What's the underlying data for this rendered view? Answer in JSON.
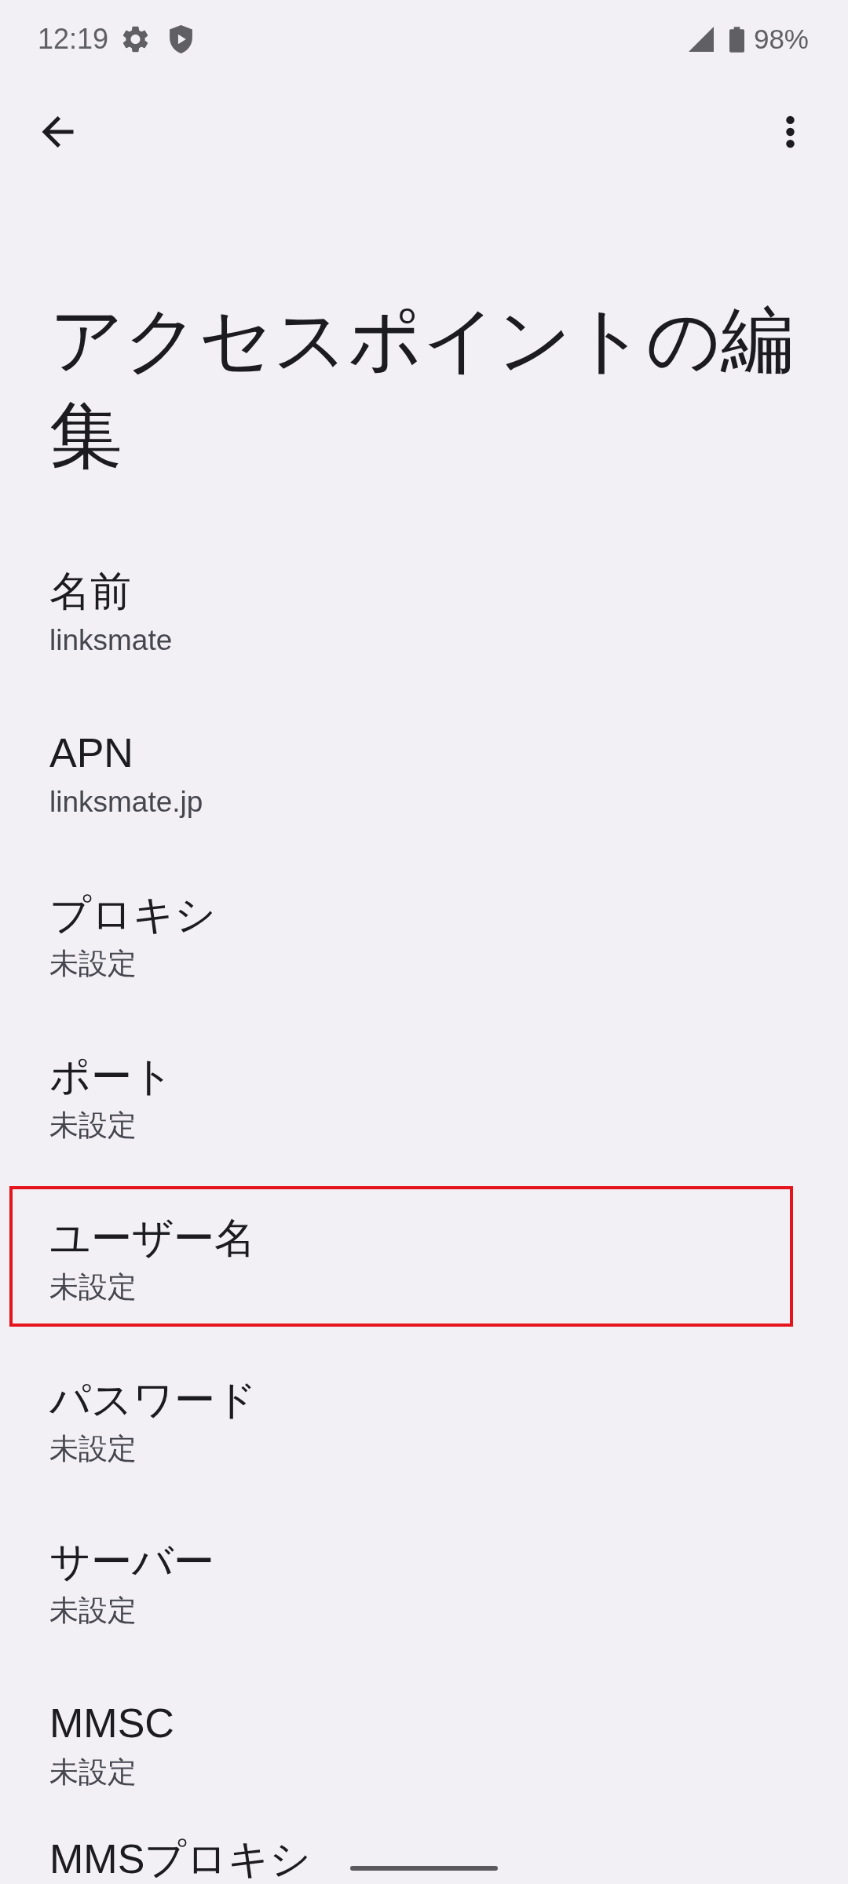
{
  "status_bar": {
    "time": "12:19",
    "battery": "98%"
  },
  "title": "アクセスポイントの編集",
  "items": [
    {
      "title": "名前",
      "summary": "linksmate",
      "highlighted": false
    },
    {
      "title": "APN",
      "summary": "linksmate.jp",
      "highlighted": false
    },
    {
      "title": "プロキシ",
      "summary": "未設定",
      "highlighted": false
    },
    {
      "title": "ポート",
      "summary": "未設定",
      "highlighted": false
    },
    {
      "title": "ユーザー名",
      "summary": "未設定",
      "highlighted": true
    },
    {
      "title": "パスワード",
      "summary": "未設定",
      "highlighted": false
    },
    {
      "title": "サーバー",
      "summary": "未設定",
      "highlighted": false
    },
    {
      "title": "MMSC",
      "summary": "未設定",
      "highlighted": false
    },
    {
      "title": "MMSプロキシ",
      "highlighted": false
    }
  ]
}
